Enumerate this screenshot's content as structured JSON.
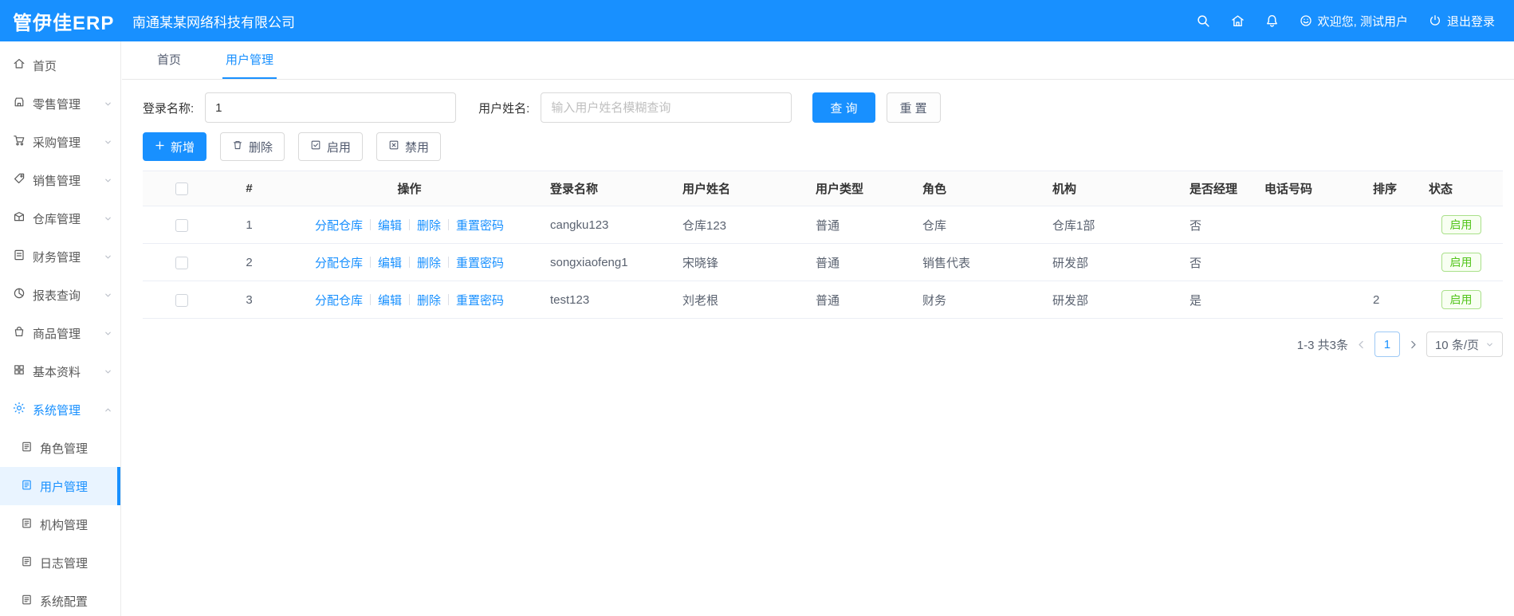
{
  "app": {
    "logo": "管伊佳ERP",
    "company": "南通某某网络科技有限公司"
  },
  "header": {
    "welcome": "欢迎您, 测试用户",
    "logout": "退出登录"
  },
  "sidebar": {
    "items": [
      {
        "label": "首页"
      },
      {
        "label": "零售管理"
      },
      {
        "label": "采购管理"
      },
      {
        "label": "销售管理"
      },
      {
        "label": "仓库管理"
      },
      {
        "label": "财务管理"
      },
      {
        "label": "报表查询"
      },
      {
        "label": "商品管理"
      },
      {
        "label": "基本资料"
      },
      {
        "label": "系统管理"
      }
    ],
    "submenu": [
      {
        "label": "角色管理"
      },
      {
        "label": "用户管理"
      },
      {
        "label": "机构管理"
      },
      {
        "label": "日志管理"
      },
      {
        "label": "系统配置"
      }
    ]
  },
  "tabs": {
    "home": "首页",
    "current": "用户管理"
  },
  "filters": {
    "login_label": "登录名称:",
    "login_value": "1",
    "name_label": "用户姓名:",
    "name_placeholder": "输入用户姓名模糊查询",
    "search": "查 询",
    "reset": "重 置"
  },
  "toolbar": {
    "add": "新增",
    "delete": "删除",
    "enable": "启用",
    "disable": "禁用"
  },
  "table": {
    "columns": [
      "#",
      "操作",
      "登录名称",
      "用户姓名",
      "用户类型",
      "角色",
      "机构",
      "是否经理",
      "电话号码",
      "排序",
      "状态"
    ],
    "ops": [
      "分配仓库",
      "编辑",
      "删除",
      "重置密码"
    ],
    "rows": [
      {
        "index": "1",
        "login": "cangku123",
        "name": "仓库123",
        "type": "普通",
        "role": "仓库",
        "org": "仓库1部",
        "manager": "否",
        "phone": "",
        "sort": "",
        "status": "启用"
      },
      {
        "index": "2",
        "login": "songxiaofeng1",
        "name": "宋晓锋",
        "type": "普通",
        "role": "销售代表",
        "org": "研发部",
        "manager": "否",
        "phone": "",
        "sort": "",
        "status": "启用"
      },
      {
        "index": "3",
        "login": "test123",
        "name": "刘老根",
        "type": "普通",
        "role": "财务",
        "org": "研发部",
        "manager": "是",
        "phone": "",
        "sort": "2",
        "status": "启用"
      }
    ]
  },
  "pagination": {
    "total": "1-3 共3条",
    "page": "1",
    "page_size": "10 条/页"
  }
}
